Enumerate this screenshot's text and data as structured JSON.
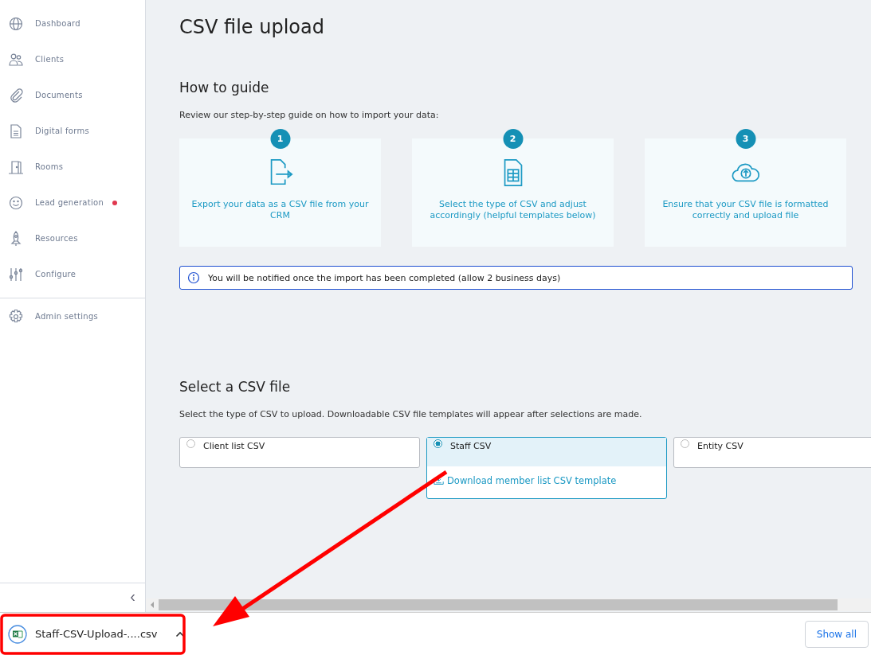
{
  "sidebar": {
    "items": [
      {
        "label": "Dashboard",
        "dot": false
      },
      {
        "label": "Clients",
        "dot": false
      },
      {
        "label": "Documents",
        "dot": false
      },
      {
        "label": "Digital forms",
        "dot": false
      },
      {
        "label": "Rooms",
        "dot": false
      },
      {
        "label": "Lead generation",
        "dot": true
      },
      {
        "label": "Resources",
        "dot": false
      },
      {
        "label": "Configure",
        "dot": false
      }
    ],
    "footer_items": [
      {
        "label": "Admin settings"
      }
    ],
    "collapse": "‹"
  },
  "page": {
    "title": "CSV file upload",
    "guide": {
      "heading": "How to guide",
      "intro": "Review our step-by-step guide on how to import your data:",
      "steps": [
        {
          "number": "1",
          "text": "Export your data as a CSV file from your CRM"
        },
        {
          "number": "2",
          "text": "Select the type of CSV and adjust accordingly (helpful templates below)"
        },
        {
          "number": "3",
          "text": "Ensure that your CSV file is formatted correctly and upload file"
        }
      ],
      "notice": "You will be notified once the import has been completed (allow 2 business days)"
    },
    "select": {
      "heading": "Select a CSV file",
      "intro": "Select the type of CSV to upload. Downloadable CSV file templates will appear after selections are made.",
      "options": [
        {
          "label": "Client list CSV",
          "selected": false
        },
        {
          "label": "Staff CSV",
          "selected": true,
          "template_link": "Download member list CSV template"
        },
        {
          "label": "Entity CSV",
          "selected": false
        }
      ]
    }
  },
  "download_bar": {
    "file": "Staff-CSV-Upload-....csv",
    "show_all": "Show all"
  }
}
